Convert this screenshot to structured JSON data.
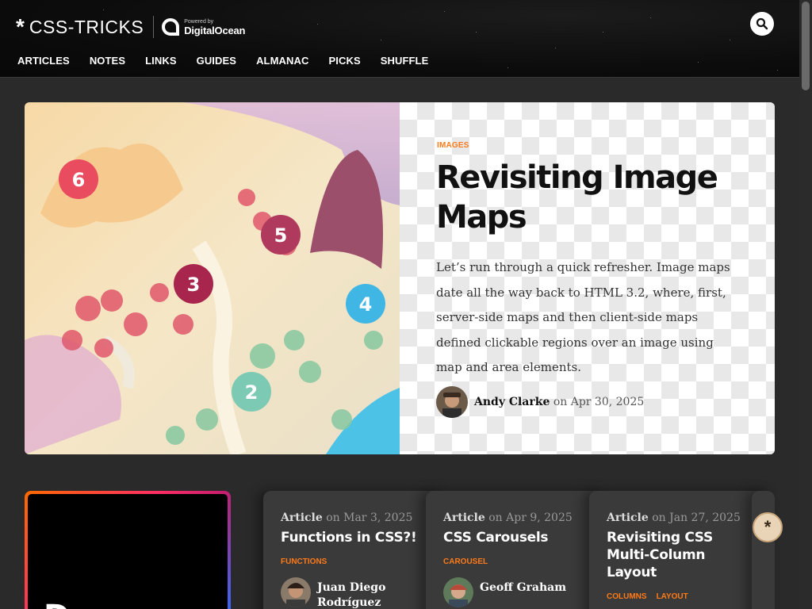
{
  "header": {
    "logo_text": "CSS-TRICKS",
    "sponsor_powered": "Powered by",
    "sponsor_name": "DigitalOcean",
    "nav": [
      "ARTICLES",
      "NOTES",
      "LINKS",
      "GUIDES",
      "ALMANAC",
      "PICKS",
      "SHUFFLE"
    ]
  },
  "hero": {
    "category": "IMAGES",
    "title": "Revisiting Image Maps",
    "excerpt": "Let’s run through a quick refresher. Image maps date all the way back to HTML 3.2, where, first, server-side maps and then client-side maps defined clickable regions over an image using map and area elements.",
    "author": "Andy Clarke",
    "date_prefix": "on",
    "date": "Apr 30, 2025",
    "map_markers": [
      "6",
      "5",
      "3",
      "4",
      "2"
    ]
  },
  "promo": {
    "text": "Dr..."
  },
  "cards": [
    {
      "type": "Article",
      "date": "on Mar 3, 2025",
      "title": "Functions in CSS?!",
      "tags": [
        "FUNCTIONS"
      ],
      "author": "Juan Diego Rodríguez"
    },
    {
      "type": "Article",
      "date": "on Apr 9, 2025",
      "title": "CSS Carousels",
      "tags": [
        "CAROUSEL"
      ],
      "author": "Geoff Graham"
    },
    {
      "type": "Article",
      "date": "on Jan 27, 2025",
      "title": "Revisiting CSS Multi-Column Layout",
      "tags": [
        "COLUMNS",
        "LAYOUT"
      ],
      "author": ""
    }
  ],
  "colors": {
    "accent": "#ff7a18",
    "background": "#2a2a2a",
    "card": "#3a3a3a"
  },
  "icons": {
    "search": "search-icon",
    "logo": "asterisk-icon",
    "badge": "cookie-icon"
  }
}
